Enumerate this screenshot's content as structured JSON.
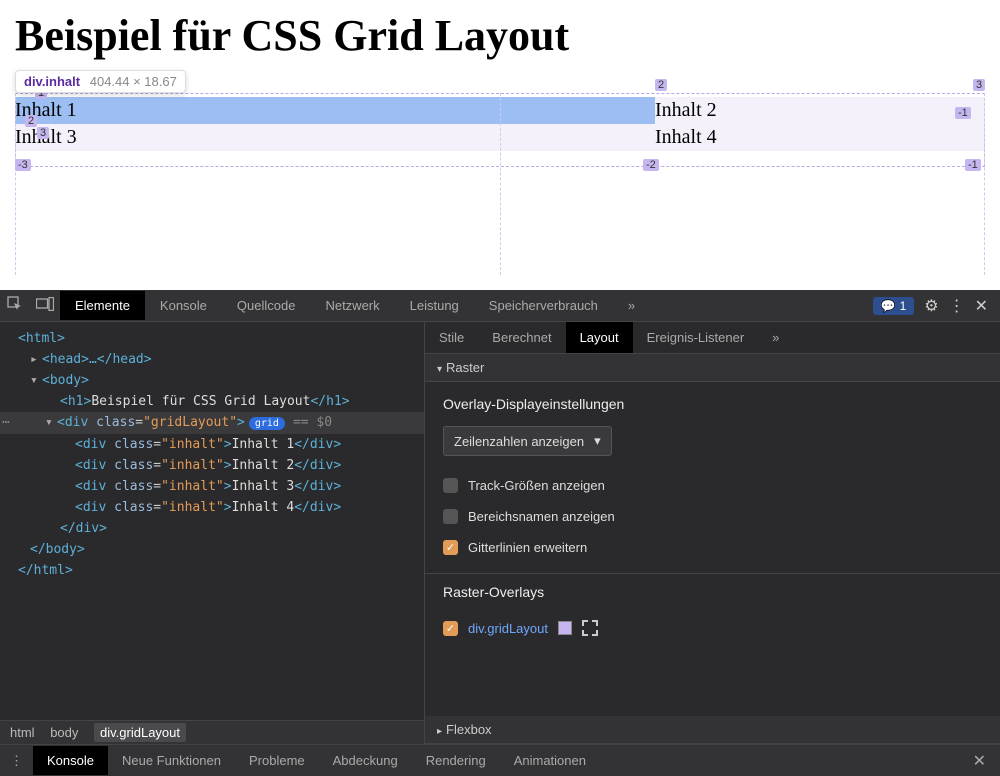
{
  "page": {
    "title": "Beispiel für CSS Grid Layout",
    "tooltip_selector": "div.inhalt",
    "tooltip_dims": "404.44 × 18.67",
    "cells": [
      "Inhalt 1",
      "Inhalt 2",
      "Inhalt 3",
      "Inhalt 4"
    ],
    "line_numbers": {
      "top_left": "1",
      "top_mid": "2",
      "top_right": "3",
      "mid_left": "2",
      "mid_left2": "3",
      "bot_left": "-3",
      "bot_mid": "-2",
      "bot_right_a": "-1",
      "bot_right_b": "-1"
    }
  },
  "devtools_tabs": {
    "inspect_icon": "⇱",
    "device_icon": "▭",
    "items": [
      "Elemente",
      "Konsole",
      "Quellcode",
      "Netzwerk",
      "Leistung",
      "Speicherverbrauch"
    ],
    "more": "»",
    "msg_count": "1"
  },
  "dom": {
    "html_open": "<html>",
    "head": "<head>…</head>",
    "body_open": "<body>",
    "h1_open": "<h1>",
    "h1_text": "Beispiel für CSS Grid Layout",
    "h1_close": "</h1>",
    "div_grid_open_tag": "div",
    "div_grid_class_attr": "class",
    "div_grid_class_val": "\"gridLayout\"",
    "grid_badge": "grid",
    "eq0": "== $0",
    "inhalt_tag": "div",
    "inhalt_class_attr": "class",
    "inhalt_class_val": "\"inhalt\"",
    "inhalt_texts": [
      "Inhalt 1",
      "Inhalt 2",
      "Inhalt 3",
      "Inhalt 4"
    ],
    "div_close": "</div>",
    "body_close": "</body>",
    "html_close": "</html>"
  },
  "breadcrumb": {
    "items": [
      "html",
      "body",
      "div.gridLayout"
    ]
  },
  "side_tabs": {
    "items": [
      "Stile",
      "Berechnet",
      "Layout",
      "Ereignis-Listener"
    ],
    "more": "»"
  },
  "layout_panel": {
    "section_raster": "Raster",
    "heading_overlay": "Overlay-Displayeinstellungen",
    "select_value": "Zeilenzahlen anzeigen",
    "check_track": "Track-Größen anzeigen",
    "check_area": "Bereichsnamen anzeigen",
    "check_grid": "Gitterlinien erweitern",
    "heading_overlays": "Raster-Overlays",
    "overlay_item": "div.gridLayout",
    "section_flexbox": "Flexbox"
  },
  "drawer": {
    "items": [
      "Konsole",
      "Neue Funktionen",
      "Probleme",
      "Abdeckung",
      "Rendering",
      "Animationen"
    ]
  }
}
